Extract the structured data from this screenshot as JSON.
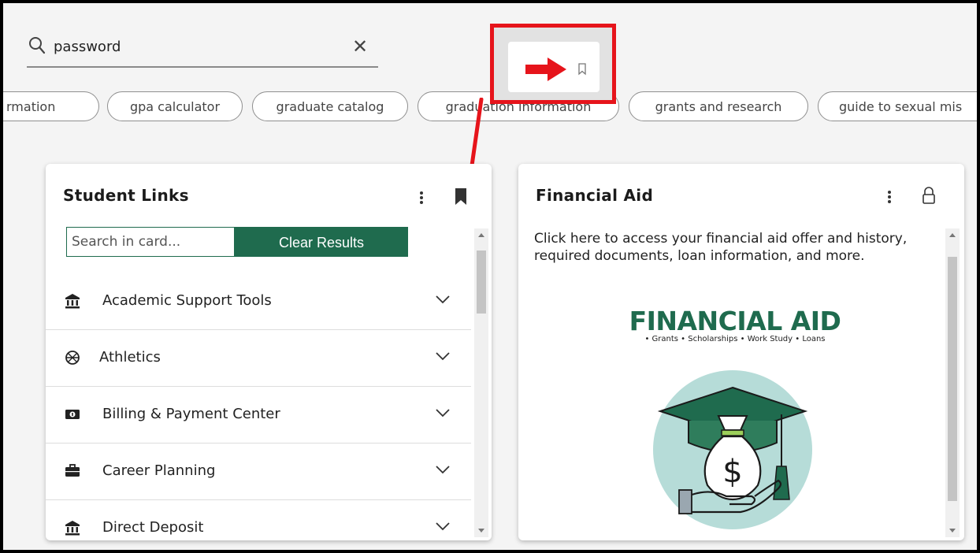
{
  "search": {
    "value": "password",
    "placeholder": "Search"
  },
  "chips": [
    "rmation",
    "gpa calculator",
    "graduate catalog",
    "graduation information",
    "grants and research",
    "guide to sexual mis"
  ],
  "student_links": {
    "title": "Student Links",
    "search_placeholder": "Search in card...",
    "clear_label": "Clear Results",
    "items": [
      {
        "label": "Academic Support Tools",
        "icon": "bank-icon"
      },
      {
        "label": "Athletics",
        "icon": "ball-icon"
      },
      {
        "label": "Billing & Payment Center",
        "icon": "money-icon"
      },
      {
        "label": "Career Planning",
        "icon": "briefcase-icon"
      },
      {
        "label": "Direct Deposit",
        "icon": "bank-icon"
      }
    ]
  },
  "financial_aid": {
    "title": "Financial Aid",
    "description": "Click here to access your financial aid offer and history, required documents, loan information, and more.",
    "logo_title": "FINANCIAL AID",
    "logo_subtitle": "• Grants • Scholarships • Work Study • Loans",
    "illustration_symbol": "$"
  },
  "colors": {
    "brand_green": "#1f6b4e",
    "highlight_red": "#e6141b",
    "illustration_circle": "#b6dcd8"
  }
}
